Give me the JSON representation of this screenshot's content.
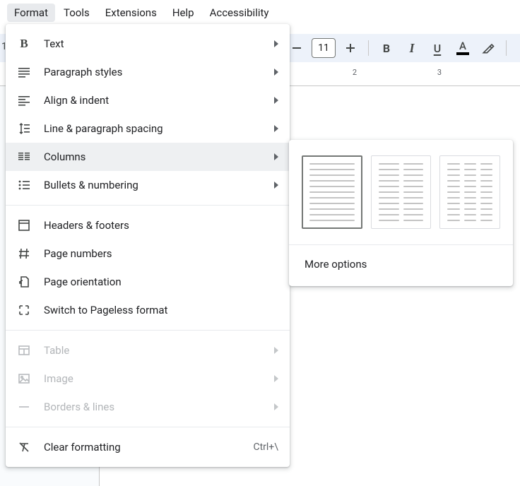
{
  "menubar": {
    "format": "Format",
    "tools": "Tools",
    "extensions": "Extensions",
    "help": "Help",
    "accessibility": "Accessibility"
  },
  "toolbar": {
    "font_size": "11",
    "one_label": "1"
  },
  "ruler": {
    "mark_2": "2",
    "mark_3": "3"
  },
  "format_menu": {
    "text": "Text",
    "paragraph_styles": "Paragraph styles",
    "align_indent": "Align & indent",
    "line_spacing": "Line & paragraph spacing",
    "columns": "Columns",
    "bullets_numbering": "Bullets & numbering",
    "headers_footers": "Headers & footers",
    "page_numbers": "Page numbers",
    "page_orientation": "Page orientation",
    "switch_pageless": "Switch to Pageless format",
    "table": "Table",
    "image": "Image",
    "borders_lines": "Borders & lines",
    "clear_formatting": "Clear formatting",
    "clear_formatting_shortcut": "Ctrl+\\"
  },
  "columns_submenu": {
    "more_options": "More options"
  }
}
